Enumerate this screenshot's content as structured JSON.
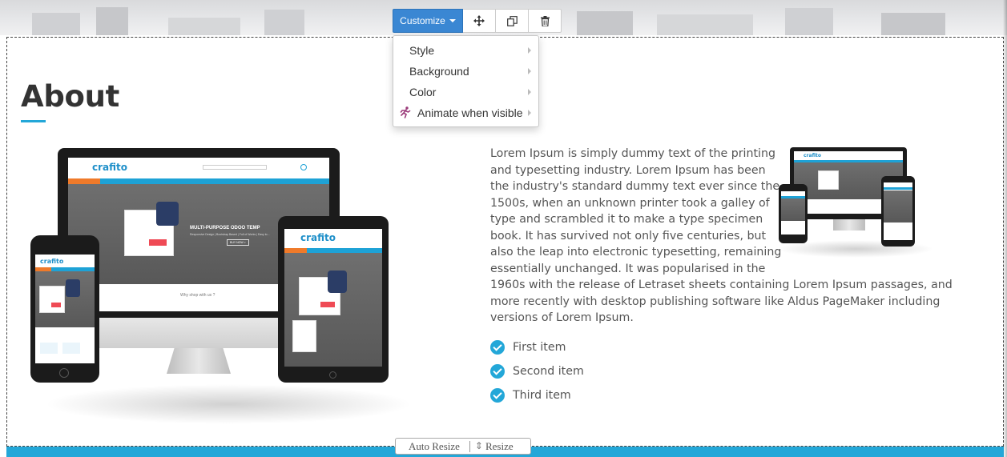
{
  "toolbar": {
    "customize_label": "Customize",
    "move_icon": "move-arrows-icon",
    "clone_icon": "clone-icon",
    "delete_icon": "trash-icon",
    "accent": "#3a87d3"
  },
  "dropdown": {
    "items": [
      {
        "label": "Style"
      },
      {
        "label": "Background"
      },
      {
        "label": "Color"
      },
      {
        "label": "Animate when visible",
        "icon": "running-man-icon"
      }
    ]
  },
  "section": {
    "title": "About",
    "accent": "#23a7d8",
    "paragraph_lines": [
      "Lorem Ipsum is simply dummy text of the printing",
      "and typesetting industry. Lorem Ipsum has been",
      "the industry's standard dummy text ever since the",
      "1500s, when an unknown printer took a galley of",
      "type and scrambled it to make a type specimen",
      "book. It has survived not only five centuries, but",
      "also the leap into electronic typesetting, remaining",
      "essentially unchanged. It was popularised in the",
      "1960s with the release of Letraset sheets containing Lorem Ipsum passages, and",
      "more recently with desktop publishing software like Aldus PageMaker including",
      "versions of Lorem Ipsum."
    ],
    "checklist": [
      "First item",
      "Second item",
      "Third item"
    ]
  },
  "mockup": {
    "logo": "crafito",
    "hero_title": "MULTI-PURPOSE ODOO TEMP",
    "hero_sub": "Responsive Design | Bootstrap Based | Full of Works | Easy to...",
    "button": "BUY NOW >",
    "why_text": "Why shop with us ?",
    "card_title": "RED BLAZERS",
    "card_sale": "SALE",
    "small_text": "WHY CHOOSE US?",
    "nav_items": [
      "ALL DEPARTMENTS",
      "HOME",
      "ABOUT",
      "CATALOG",
      "SHOP",
      "FEATURES",
      "SUBSCRIBE",
      "CONTACT"
    ],
    "small_logo": "crafito"
  },
  "resize_bar": {
    "auto_resize": "Auto Resize",
    "resize": "Resize"
  }
}
